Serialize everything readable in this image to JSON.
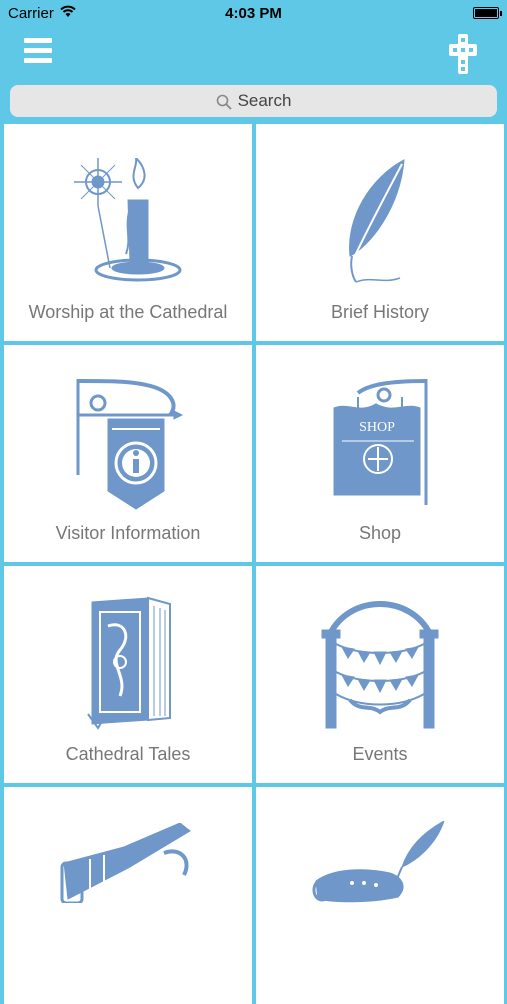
{
  "status_bar": {
    "carrier": "Carrier",
    "time": "4:03 PM"
  },
  "navbar": {
    "menu_icon": "hamburger-icon",
    "right_icon": "cathedral-cross-icon"
  },
  "search": {
    "placeholder": "Search",
    "icon": "search-icon"
  },
  "tiles": [
    {
      "label": "Worship at the Cathedral",
      "icon": "candle-icon"
    },
    {
      "label": "Brief History",
      "icon": "quill-icon"
    },
    {
      "label": "Visitor Information",
      "icon": "info-banner-icon"
    },
    {
      "label": "Shop",
      "icon": "shop-sign-icon"
    },
    {
      "label": "Cathedral Tales",
      "icon": "book-icon"
    },
    {
      "label": "Events",
      "icon": "bunting-arch-icon"
    },
    {
      "label": "",
      "icon": "bugle-sword-icon"
    },
    {
      "label": "",
      "icon": "scroll-quill-icon"
    }
  ],
  "colors": {
    "background": "#5ec8e6",
    "icon": "#6f97c9",
    "label": "#777777"
  }
}
